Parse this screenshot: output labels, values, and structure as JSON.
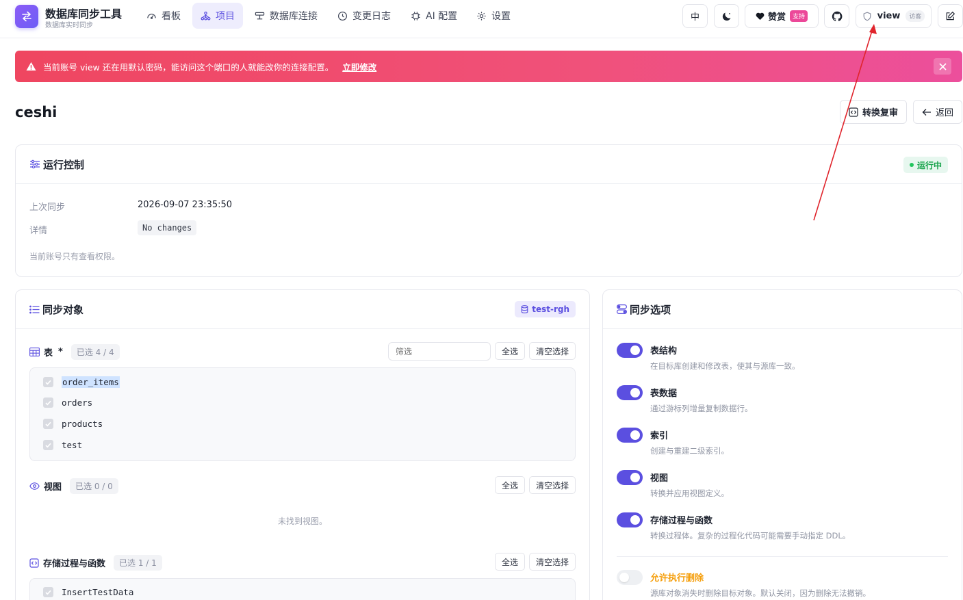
{
  "header": {
    "app_title": "数据库同步工具",
    "app_subtitle": "数据库实时同步",
    "nav": [
      {
        "label": "看板"
      },
      {
        "label": "项目"
      },
      {
        "label": "数据库连接"
      },
      {
        "label": "变更日志"
      },
      {
        "label": "AI 配置"
      },
      {
        "label": "设置"
      }
    ],
    "lang_label": "中",
    "sponsor_label": "赞赏",
    "sponsor_badge": "支持",
    "user_name": "view",
    "user_role": "访客"
  },
  "alert": {
    "message": "当前账号 view 还在用默认密码，能访问这个端口的人就能改你的连接配置。",
    "link_label": "立即修改"
  },
  "page": {
    "title": "ceshi",
    "convert_label": "转换复审",
    "back_label": "返回"
  },
  "run_control": {
    "title": "运行控制",
    "status": "运行中",
    "last_sync_label": "上次同步",
    "last_sync_value": "2026-09-07 23:35:50",
    "detail_label": "详情",
    "detail_value": "No changes",
    "permission_note": "当前账号只有查看权限。"
  },
  "sync_objects": {
    "title": "同步对象",
    "source_chip": "test-rgh",
    "tables": {
      "title": "表",
      "required_mark": "*",
      "count": "已选 4 / 4",
      "filter_placeholder": "筛选",
      "select_all": "全选",
      "clear": "清空选择",
      "items": [
        "order_items",
        "orders",
        "products",
        "test"
      ]
    },
    "views": {
      "title": "视图",
      "count": "已选 0 / 0",
      "select_all": "全选",
      "clear": "清空选择",
      "empty": "未找到视图。"
    },
    "routines": {
      "title": "存储过程与函数",
      "count": "已选 1 / 1",
      "select_all": "全选",
      "clear": "清空选择",
      "items": [
        "InsertTestData"
      ]
    }
  },
  "sync_options": {
    "title": "同步选项",
    "options": [
      {
        "title": "表结构",
        "desc": "在目标库创建和修改表，使其与源库一致。",
        "enabled": true
      },
      {
        "title": "表数据",
        "desc": "通过游标列增量复制数据行。",
        "enabled": true
      },
      {
        "title": "索引",
        "desc": "创建与重建二级索引。",
        "enabled": true
      },
      {
        "title": "视图",
        "desc": "转换并应用视图定义。",
        "enabled": true
      },
      {
        "title": "存储过程与函数",
        "desc": "转换过程体。复杂的过程化代码可能需要手动指定 DDL。",
        "enabled": true
      },
      {
        "title": "允许执行删除",
        "desc": "源库对象消失时删除目标对象。默认关闭，因为删除无法撤销。",
        "enabled": false
      }
    ]
  },
  "colors": {
    "accent": "#5b4fe0",
    "alert_start": "#ef4660",
    "alert_end": "#ec4f9c",
    "success": "#16a34a",
    "warning": "#f59e0b"
  }
}
